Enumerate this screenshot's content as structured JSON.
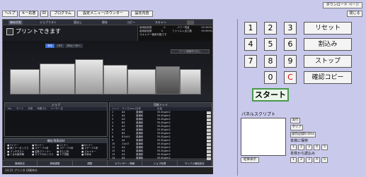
{
  "topbar": {
    "buttons": [
      "ヘルプ",
      "キー応答",
      "ID",
      "プログラム",
      "設定メニュー/カウンター",
      "設定内容"
    ],
    "download_page": "ダウンロード ページ",
    "close": "閉じる"
  },
  "screen": {
    "menu": [
      "機械状態",
      "ジョブリスト",
      "読出し",
      "保存",
      "コピー",
      "スキャン"
    ],
    "status": "プリントできます",
    "counters": [
      {
        "label": "使用総枚数",
        "value": "0",
        "label2": "パワー残量",
        "value2": "99.999%"
      },
      {
        "label": "使用総枚数",
        "value": "0",
        "label2": "ファイル入出力数",
        "value2": "99.999%"
      }
    ],
    "scanner_label": "スキャナー使用可能です",
    "mode_tabs": [
      "有効",
      "OFF",
      "PDヒーター"
    ],
    "fault_label": "ワーン情報呼び出し",
    "job_panel": {
      "title": "ジョブ",
      "headers": [
        "No.",
        "モード",
        "状態",
        "時間(分)",
        "ユーザー名"
      ]
    },
    "info_panel": {
      "title": "補給/廃棄部材",
      "items": [
        "Yトナー",
        "Mトナー",
        "Cトナー",
        "Kトナー",
        "廃トナーボックス",
        "ステープル針",
        "ステープル針",
        "ステープル針",
        "パンチダスト",
        "定着クリーナー",
        "中とじ針",
        "スキャナー",
        "くるみ製本糊",
        "マイクロボックス",
        "エア供給",
        "冷却水"
      ]
    },
    "tray_panel": {
      "title": "用紙トレイ",
      "headers": [
        "トレイ",
        "サイズ(mm)",
        "名称",
        "目量"
      ],
      "rows": [
        {
          "tray": "1",
          "size": "A4",
          "name": "普通紙",
          "weight": "55-81g/m2"
        },
        {
          "tray": "2",
          "size": "A4",
          "name": "普通紙",
          "weight": "55-81g/m2"
        },
        {
          "tray": "3",
          "size": "A3",
          "name": "普通紙",
          "weight": "55-81g/m2"
        },
        {
          "tray": "4",
          "size": "B4",
          "name": "普通紙",
          "weight": "55-81g/m2"
        },
        {
          "tray": "5",
          "size": "A3",
          "name": "普通紙",
          "weight": "55-81g/m2"
        },
        {
          "tray": "6",
          "size": "A4",
          "name": "普通紙",
          "weight": "55-81g/m2"
        },
        {
          "tray": "7",
          "size": "B5",
          "name": "普通紙",
          "weight": "55-81g/m2"
        },
        {
          "tray": "8",
          "size": "8.5x11",
          "name": "普通紙",
          "weight": "55-81g/m2"
        },
        {
          "tray": "9",
          "size": "A4",
          "name": "普通紙",
          "weight": "55-81g/m2"
        },
        {
          "tray": "10",
          "size": "11x17",
          "name": "普通紙",
          "weight": "55-81g/m2"
        },
        {
          "tray": "11",
          "size": "A3",
          "name": "普通紙",
          "weight": "55-81g/m2"
        },
        {
          "tray": "12",
          "size": "A4",
          "name": "普通紙",
          "weight": "55-81g/m2"
        },
        {
          "tray": "13",
          "size": "A3",
          "name": "普通紙",
          "weight": "55-81g/m2"
        },
        {
          "tray": "14",
          "size": "A4",
          "name": "普通紙",
          "weight": "55-81g/m2"
        },
        {
          "tray": "15",
          "size": "A3",
          "name": "普通紙",
          "weight": "55-81g/m2"
        }
      ]
    },
    "bottom_tabs": [
      "機械設定",
      "原稿調整",
      "調整",
      "カウンター・情報",
      "ジョブ処理",
      "サンプル機能設定"
    ],
    "footer": "14:21  プリンタ 印刷待ち"
  },
  "keypad": {
    "digits": [
      "1",
      "2",
      "3",
      "4",
      "5",
      "6",
      "7",
      "8",
      "9",
      "0"
    ],
    "clear_key": "C",
    "reset": "リセット",
    "interrupt": "割込み",
    "stop": "ストップ",
    "proof": "確認コピー",
    "start": "スタート",
    "panel_script_label": "パネルスクリプト",
    "result": "結果表示",
    "run": "実行",
    "clear": "クリア",
    "interval": "操作記録0.0ms",
    "save_label": "本体に保存",
    "load_label": "本体から読込み",
    "save_slots": [
      "1",
      "2",
      "3",
      "4",
      "5"
    ],
    "load_slots": [
      "1",
      "2",
      "3",
      "4",
      "5"
    ]
  },
  "colors": {
    "background": "#c9c9ec",
    "start_border": "#4a9a4a",
    "clear_key": "#e00000",
    "screen_bg": "#1a1c22",
    "active_tab": "#3a6fd8"
  }
}
